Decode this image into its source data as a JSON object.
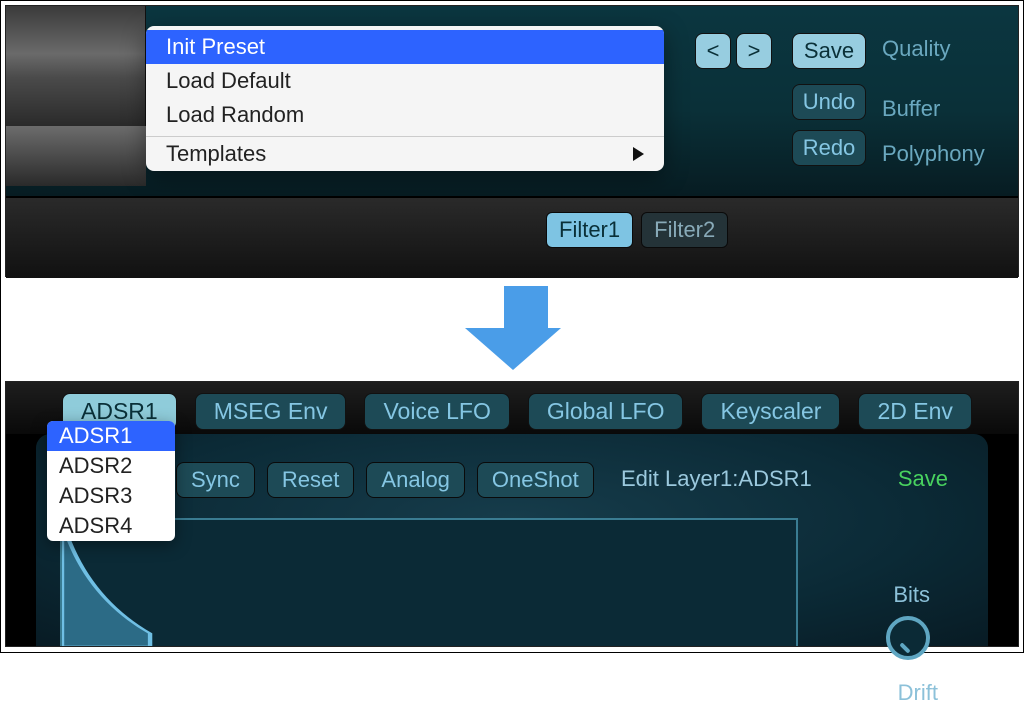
{
  "top": {
    "menu": {
      "init": "Init Preset",
      "load_default": "Load Default",
      "load_random": "Load Random",
      "templates": "Templates"
    },
    "prev": "<",
    "next": ">",
    "save": "Save",
    "undo": "Undo",
    "redo": "Redo",
    "labels": {
      "quality": "Quality",
      "buffer": "Buffer",
      "polyphony": "Polyphony"
    },
    "filter_tabs": {
      "f1": "Filter1",
      "f2": "Filter2"
    }
  },
  "bottom": {
    "tabs": {
      "adsr1": "ADSR1",
      "mseg": "MSEG Env",
      "voice_lfo": "Voice LFO",
      "global_lfo": "Global LFO",
      "keyscaler": "Keyscaler",
      "env2d": "2D Env"
    },
    "dropdown": {
      "o1": "ADSR1",
      "o2": "ADSR2",
      "o3": "ADSR3",
      "o4": "ADSR4"
    },
    "row": {
      "sync": "Sync",
      "reset": "Reset",
      "analog": "Analog",
      "oneshot": "OneShot"
    },
    "edit": "Edit Layer1:ADSR1",
    "save": "Save",
    "side": {
      "bits": "Bits",
      "drift": "Drift"
    }
  }
}
